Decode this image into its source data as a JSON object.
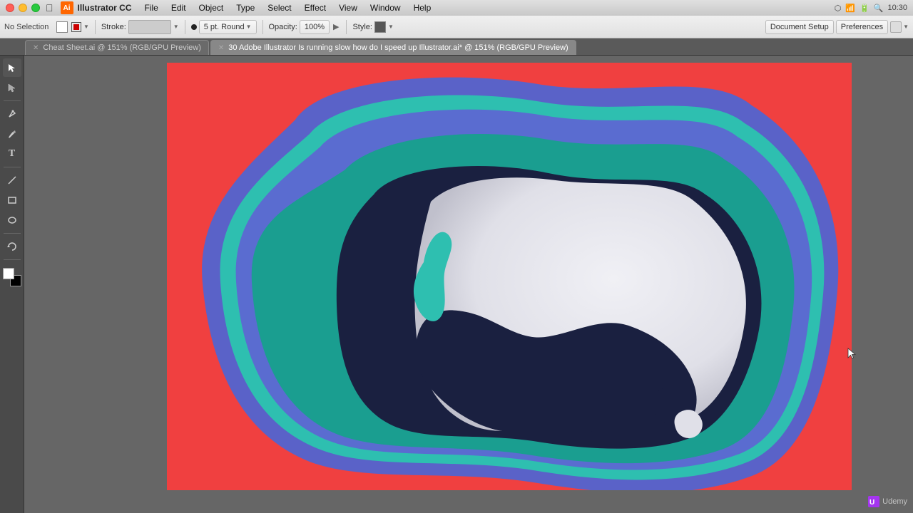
{
  "app": {
    "name": "Illustrator CC",
    "ai_logo": "Ai"
  },
  "titlebar": {
    "title": "Illustrator CC"
  },
  "menubar": {
    "items": [
      "File",
      "Edit",
      "Object",
      "Type",
      "Select",
      "Effect",
      "View",
      "Window",
      "Help"
    ]
  },
  "toolbar": {
    "selection_label": "No Selection",
    "stroke_label": "Stroke:",
    "stroke_value": "",
    "brush_size": "5 pt. Round",
    "opacity_label": "Opacity:",
    "opacity_value": "100%",
    "style_label": "Style:",
    "document_setup": "Document Setup",
    "preferences": "Preferences"
  },
  "tabs": [
    {
      "id": "tab1",
      "label": "Cheat Sheet.ai @ 151% (RGB/GPU Preview)",
      "active": false,
      "closable": true
    },
    {
      "id": "tab2",
      "label": "30 Adobe Illustrator Is running slow how do I speed up Illustrator.ai* @ 151% (RGB/GPU Preview)",
      "active": true,
      "closable": true
    }
  ],
  "tools": [
    {
      "name": "selection-tool",
      "icon": "▶",
      "active": true
    },
    {
      "name": "direct-selection-tool",
      "icon": "↗"
    },
    {
      "name": "pen-tool",
      "icon": "✒"
    },
    {
      "name": "brush-tool",
      "icon": "✏"
    },
    {
      "name": "type-tool",
      "icon": "T"
    },
    {
      "name": "line-tool",
      "icon": "╱"
    },
    {
      "name": "rectangle-tool",
      "icon": "□"
    },
    {
      "name": "ellipse-tool",
      "icon": "○"
    },
    {
      "name": "rotate-tool",
      "icon": "↻"
    }
  ],
  "canvas": {
    "bg_color": "#f04040",
    "zoom": "151%",
    "mode": "RGB/GPU Preview"
  },
  "statusbar": {
    "cursor_x": "1247",
    "cursor_y": "504"
  }
}
